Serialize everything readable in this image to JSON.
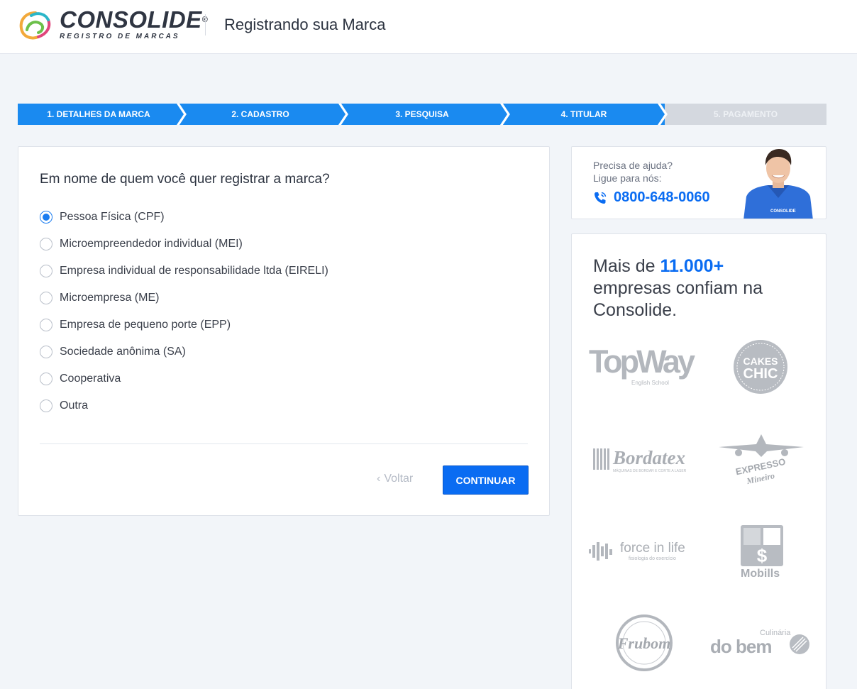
{
  "header": {
    "logo_name": "CONSOLIDE",
    "logo_registered": "®",
    "logo_sub": "REGISTRO DE MARCAS",
    "title": "Registrando sua Marca"
  },
  "steps": [
    {
      "label": "1. DETALHES DA MARCA",
      "state": "active"
    },
    {
      "label": "2. CADASTRO",
      "state": "active"
    },
    {
      "label": "3. PESQUISA",
      "state": "active"
    },
    {
      "label": "4. TITULAR",
      "state": "active"
    },
    {
      "label": "5. PAGAMENTO",
      "state": "inactive"
    }
  ],
  "form": {
    "question": "Em nome de quem você quer registrar a marca?",
    "options": [
      {
        "label": "Pessoa Física (CPF)",
        "checked": true
      },
      {
        "label": "Microempreendedor individual (MEI)",
        "checked": false
      },
      {
        "label": "Empresa individual de responsabilidade ltda (EIRELI)",
        "checked": false
      },
      {
        "label": "Microempresa (ME)",
        "checked": false
      },
      {
        "label": "Empresa de pequeno porte (EPP)",
        "checked": false
      },
      {
        "label": "Sociedade anônima (SA)",
        "checked": false
      },
      {
        "label": "Cooperativa",
        "checked": false
      },
      {
        "label": "Outra",
        "checked": false
      }
    ],
    "back_label": "Voltar",
    "continue_label": "CONTINUAR"
  },
  "help": {
    "line1": "Precisa de ajuda?",
    "line2": "Ligue para nós:",
    "phone": "0800-648-0060",
    "shirt_text": "CONSOLIDE"
  },
  "trust": {
    "prefix": "Mais de ",
    "highlight": "11.000+",
    "suffix": " empresas confiam na Consolide.",
    "brands": {
      "topway": "TopWay",
      "topway_sub": "English School",
      "cakes_top": "CAKES",
      "cakes_bottom": "CHIC",
      "bordatex": "Bordatex",
      "bordatex_sub": "MÁQUINAS DE BORDAR E CORTE A LASER",
      "expresso_top": "EXPRESSO",
      "expresso_bottom": "Mineiro",
      "force": "force in life",
      "force_sub": "fisiologia do exercício",
      "mobills": "Mobills",
      "frubom": "Frubom",
      "dobem": "do bem",
      "dobem_top": "Culinária"
    }
  },
  "colors": {
    "primary": "#0a6cf2",
    "step_active": "#1a8af0",
    "step_inactive": "#d4d8df",
    "background": "#f2f5f9"
  }
}
